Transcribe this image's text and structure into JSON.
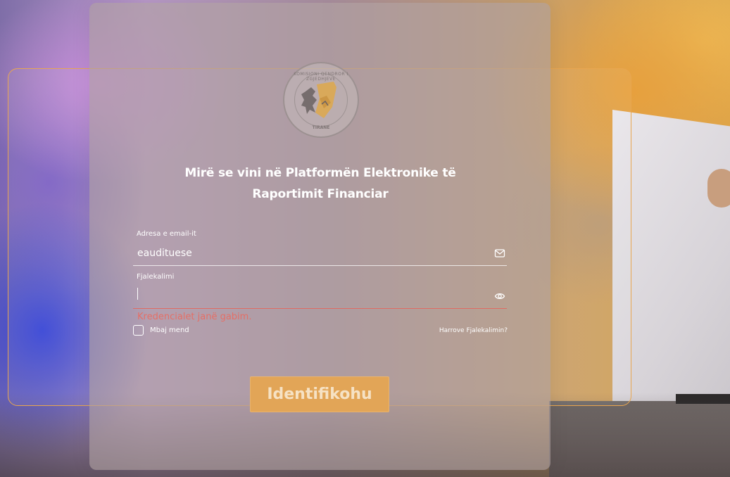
{
  "logo": {
    "top_text": "KOMISIONI QENDROR I ZGJEDHJEVE",
    "bottom_text": "TIRANE"
  },
  "title": {
    "line1": "Mirë se vini në Platformën Elektronike të",
    "line2": "Raportimit Financiar"
  },
  "email": {
    "label": "Adresa e email-it",
    "value": "eaudituese",
    "icon": "mail-icon"
  },
  "password": {
    "label": "Fjalekalimi",
    "value": "",
    "icon": "eye-icon"
  },
  "error": "Kredencialet janë gabim.",
  "remember_label": "Mbaj mend",
  "forgot_label": "Harrove Fjalekalimin?",
  "login_label": "Identifikohu",
  "colors": {
    "accent": "#e2a557",
    "error": "#e06b62",
    "frame": "#e8a650"
  }
}
